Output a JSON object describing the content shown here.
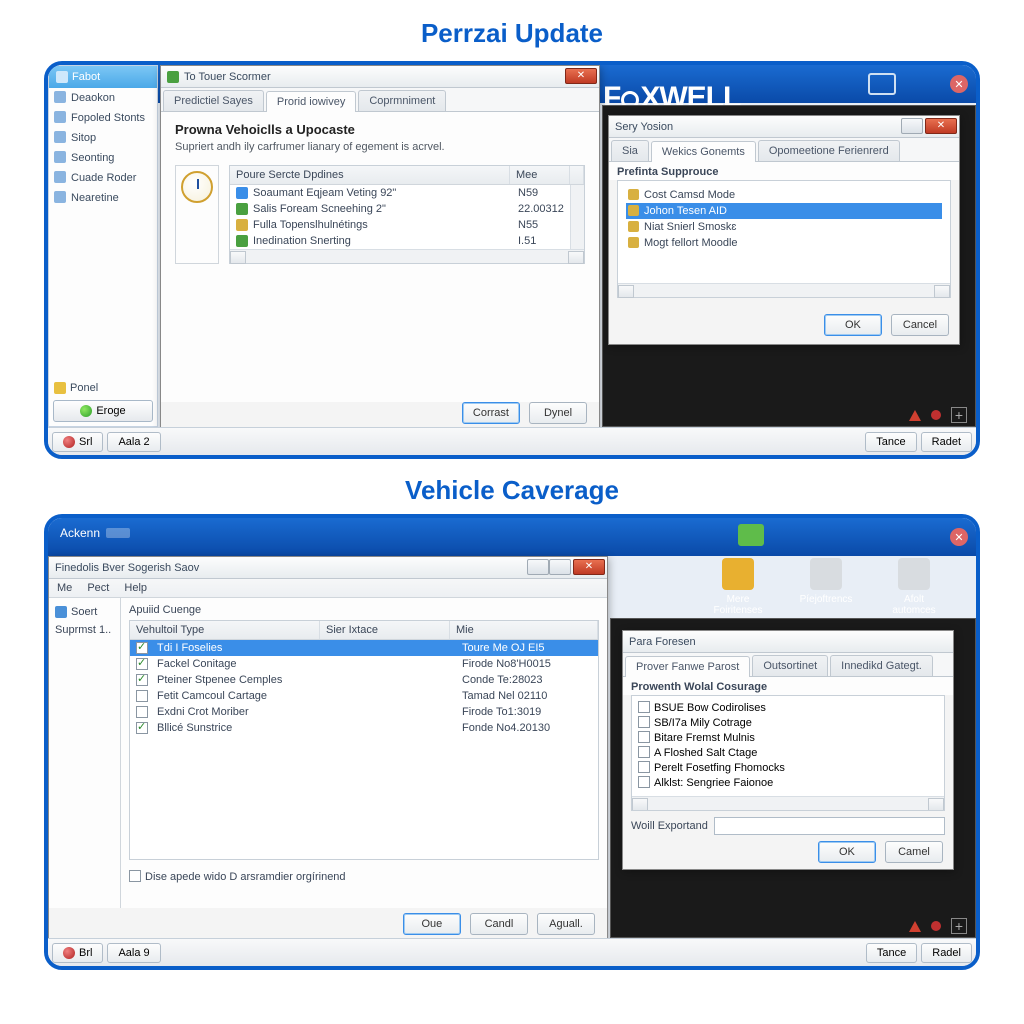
{
  "titles": {
    "top": "Perrzai Update",
    "bottom": "Vehicle Caverage"
  },
  "brand": "FOXWELL",
  "sidebar": {
    "head": "Fabot",
    "items": [
      "Deaokon",
      "Fopoled Stonts",
      "Sitop",
      "Seonting",
      "Cuade Roder",
      "Nearetine"
    ],
    "footer": "Ponel",
    "button": "Eroge"
  },
  "dlg1": {
    "title": "To Touer Scormer",
    "tabs": [
      "Predictiel Sayes",
      "Prorid iowivey",
      "Coprmniment"
    ],
    "heading": "Prowna Vehoiclls a Upocaste",
    "sub": "Supriert andh ily carfrumer lianary of egement is acrvel.",
    "table": {
      "h1": "Poure Sercte Dpdines",
      "h2": "Mee"
    },
    "rows": [
      {
        "name": "Soaumant Eqjeam Veting 92\"",
        "val": "N59",
        "color": "#3a8ee8"
      },
      {
        "name": "Salis Foream Scneehing 2\"",
        "val": "22.00312",
        "color": "#4aa040"
      },
      {
        "name": "Fulla Topenslhulnétings",
        "val": "N55",
        "color": "#d8b040"
      },
      {
        "name": "Inedination Snerting",
        "val": "I.51",
        "color": "#4aa040"
      }
    ],
    "btn1": "Corrast",
    "btn2": "Dynel"
  },
  "dlg2": {
    "title": "Sery Yosion",
    "tabs": [
      "Sia",
      "Wekics Gonemts",
      "Opomeetione Ferienrerd"
    ],
    "group": "Prefinta Supprouce",
    "items": [
      "Cost Camsd Mode",
      "Johon Tesen AID",
      "Niat Snierl Smoskɛ",
      "Mogt fellort Moodle"
    ],
    "ok": "OK",
    "cancel": "Cancel"
  },
  "statusbar": {
    "b1": "Srl",
    "b2": "Aala 2",
    "b3": "Tance",
    "b4": "Radet"
  },
  "bottom": {
    "appbar": "Ackenn",
    "win_title": "Finedolis Bver Sogerish Saov",
    "menu": [
      "Me",
      "Pect",
      "Help"
    ],
    "side1": "Soert",
    "side2": "Suprmst 1..",
    "group": "Apuiid Cuenge",
    "cols": [
      "Vehultoil Type",
      "Sier Ixtace",
      "Mie"
    ],
    "rows": [
      {
        "name": "Tdi I Foselies",
        "c2": "Toure Me OJ EI5",
        "chk": true,
        "sel": true
      },
      {
        "name": "Fackel Conitage",
        "c2": "Firode No8'H0015",
        "chk": true
      },
      {
        "name": "Pteiner Stpenee Cemples",
        "c2": "Conde Te:28023",
        "chk": true
      },
      {
        "name": "Fetit Camcoul Cartage",
        "c2": "Tamad Nel 02110",
        "chk": false
      },
      {
        "name": "Exdni Crot Moriber",
        "c2": "Firode To1:3019",
        "chk": false
      },
      {
        "name": "Bllicé Sunstrice",
        "c2": "Fonde No4.20130",
        "chk": true
      }
    ],
    "footer_chk": "Dise apede wido D arsramdier orgírinend",
    "b1": "Oue",
    "b2": "Candl",
    "b3": "Aguall.",
    "status": {
      "b1": "Brl",
      "b2": "Aala 9",
      "b3": "Tance",
      "b4": "Radel"
    },
    "desk": [
      "Mere Foiritenses",
      "Píejoftrencs",
      "Afolt automces"
    ],
    "dlg3": {
      "title": "Para Foresen",
      "tabs": [
        "Prover Fanwe Parost",
        "Outsortinet",
        "Innedikd Gategt."
      ],
      "group": "Prowenth Wolal Cosurage",
      "items": [
        "BSUE Bow Codirolises",
        "SB/I7a Mily Cotrage",
        "Bitare Fremst Mulnis",
        "A Floshed Salt Ctage",
        "Perelt Fosetfing Fhomocks",
        "Alklst: Sengriee Faionoe"
      ],
      "label": "Woill Exportand",
      "ok": "OK",
      "cancel": "Camel"
    }
  }
}
